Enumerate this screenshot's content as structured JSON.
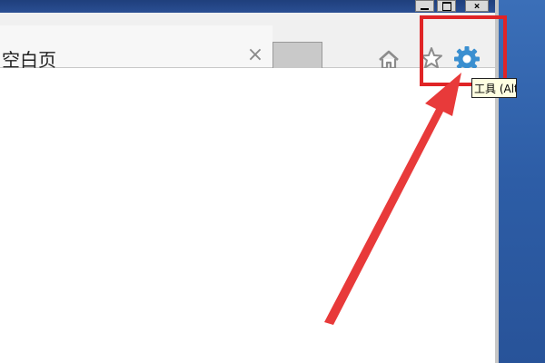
{
  "tab": {
    "title": "空白页",
    "close_glyph": "×"
  },
  "window_controls": {
    "minimize": "_",
    "maximize": "□",
    "close": "×"
  },
  "toolbar": {
    "home_icon": "home-icon",
    "favorites_icon": "star-icon",
    "tools_icon": "gear-icon",
    "tools_tooltip": "工具 (Alt+X)"
  },
  "annotation": {
    "highlight_color": "#e02426",
    "arrow_color": "#e83a3a"
  }
}
